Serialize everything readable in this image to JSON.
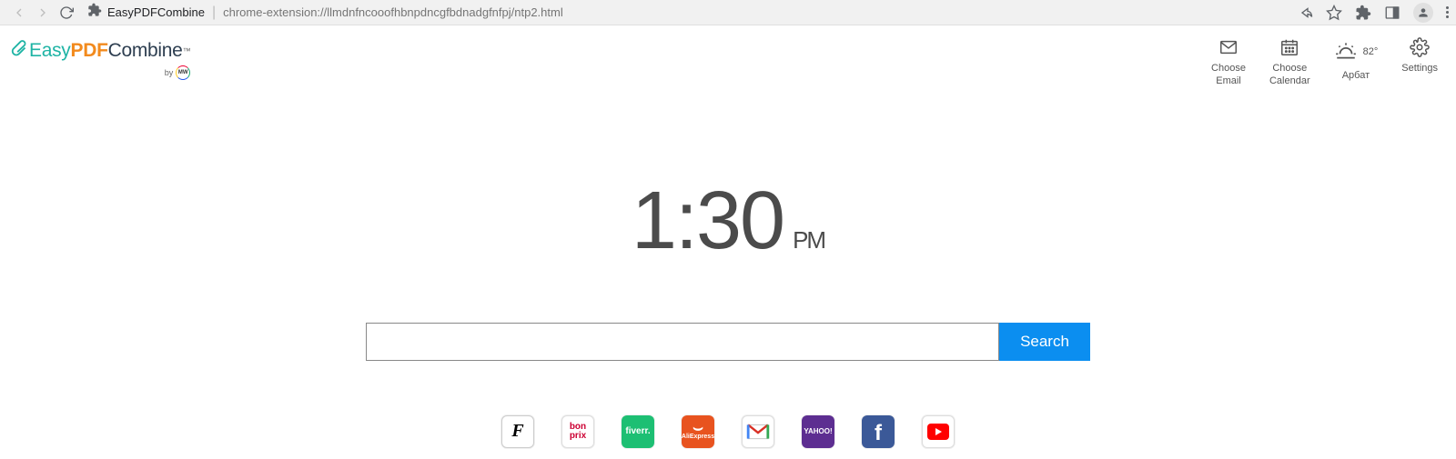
{
  "chrome": {
    "host": "EasyPDFCombine",
    "url": "chrome-extension://llmdnfncooofhbnpdncgfbdnadgfnfpj/ntp2.html"
  },
  "logo": {
    "easy": "Easy",
    "pdf": "PDF",
    "combine": "Combine",
    "tm": "™",
    "by": "by",
    "mw": "MW"
  },
  "header": {
    "email": {
      "line1": "Choose",
      "line2": "Email"
    },
    "calendar": {
      "line1": "Choose",
      "line2": "Calendar"
    },
    "weather": {
      "temp": "82°",
      "location": "Арбат"
    },
    "settings": "Settings"
  },
  "clock": {
    "time": "1:30",
    "ampm": "PM"
  },
  "search": {
    "button": "Search"
  },
  "shortcuts": {
    "farfetch": "F",
    "bonprix1": "bon",
    "bonprix2": "prix",
    "fiverr": "fiverr.",
    "aliexpress": "AliExpress",
    "yahoo": "YAHOO!",
    "facebook": "f"
  }
}
